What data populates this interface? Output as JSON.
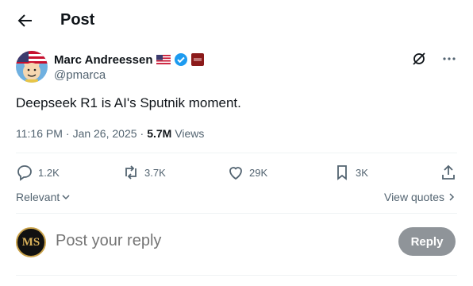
{
  "header": {
    "title": "Post"
  },
  "author": {
    "name": "Marc Andreessen",
    "handle": "@pmarca"
  },
  "tweet": {
    "text": "Deepseek R1 is AI's Sputnik moment.",
    "time": "11:16 PM",
    "sep1": "·",
    "date": "Jan 26, 2025",
    "sep2": "·",
    "views": "5.7M",
    "views_label": "Views"
  },
  "actions": {
    "replies": "1.2K",
    "reposts": "3.7K",
    "likes": "29K",
    "bookmarks": "3K"
  },
  "sort": {
    "label": "Relevant"
  },
  "view_quotes": {
    "label": "View quotes"
  },
  "reply": {
    "placeholder": "Post your reply",
    "button": "Reply",
    "avatar_initials": "MS"
  },
  "colors": {
    "verified": "#1d9bf0",
    "muted": "#536471",
    "text": "#0f1419"
  }
}
